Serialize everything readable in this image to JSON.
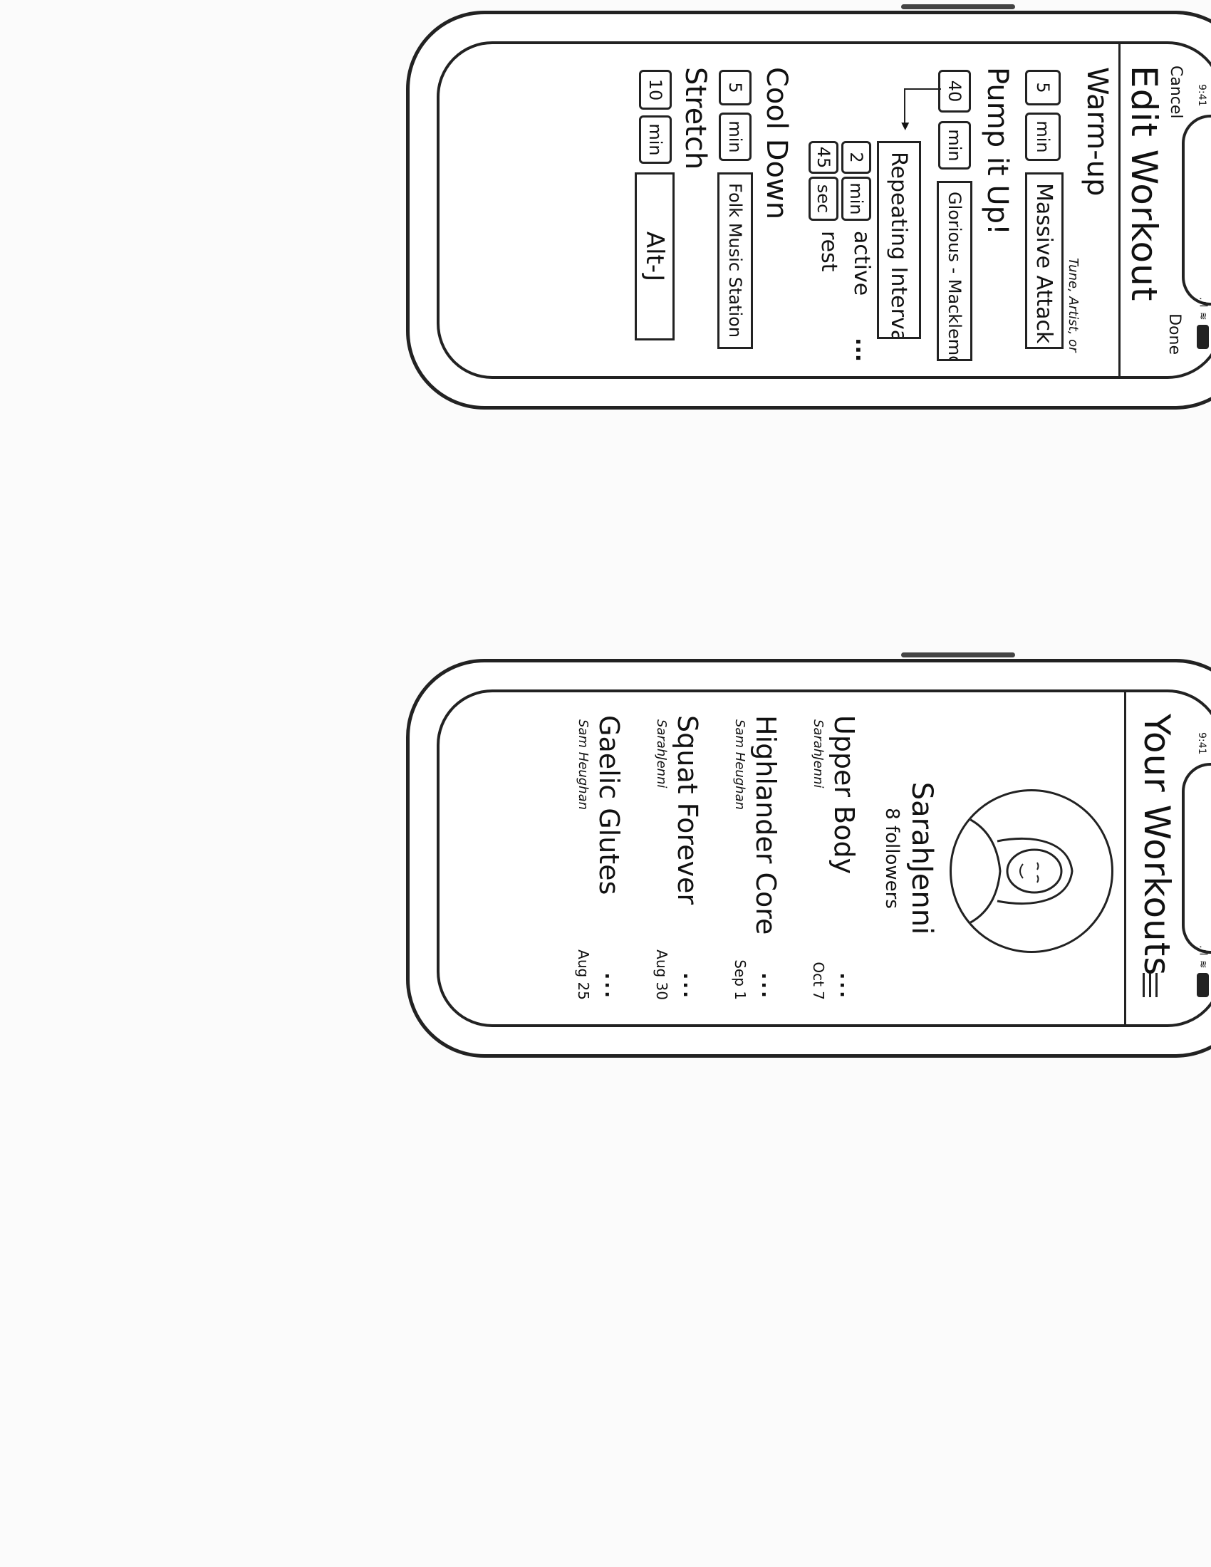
{
  "edit_screen": {
    "status": {
      "time": "9:41"
    },
    "nav": {
      "cancel": "Cancel",
      "done": "Done"
    },
    "title": "Edit Workout",
    "music_hint": "Tune, Artist, or Genre:",
    "sections": [
      {
        "name": "Warm-up",
        "duration": "5",
        "unit": "min",
        "music": "Massive Attack"
      },
      {
        "name": "Pump it Up!",
        "duration": "40",
        "unit": "min",
        "music": "Glorious - Macklemore"
      },
      {
        "name": "Cool Down",
        "duration": "5",
        "unit": "min",
        "music": "Folk Music Station"
      },
      {
        "name": "Stretch",
        "duration": "10",
        "unit": "min",
        "music": "Alt-J"
      }
    ],
    "intervals": {
      "label": "Repeating Intervals",
      "active_value": "2",
      "active_unit": "min",
      "active_label": "active",
      "rest_value": "45",
      "rest_unit": "sec",
      "rest_label": "rest",
      "more": "..."
    }
  },
  "list_screen": {
    "status": {
      "time": "9:41"
    },
    "title": "Your Workouts",
    "menu_icon": "hamburger-menu-icon",
    "profile": {
      "name": "SarahJenni",
      "followers": "8 followers"
    },
    "workouts": [
      {
        "title": "Upper Body",
        "author": "SarahJenni",
        "date": "Oct 7",
        "more": "..."
      },
      {
        "title": "Highlander Core",
        "author": "Sam Heughan",
        "date": "Sep 1",
        "more": "..."
      },
      {
        "title": "Squat Forever",
        "author": "SarahJenni",
        "date": "Aug 30",
        "more": "..."
      },
      {
        "title": "Gaelic Glutes",
        "author": "Sam Heughan",
        "date": "Aug 25",
        "more": "..."
      }
    ]
  }
}
